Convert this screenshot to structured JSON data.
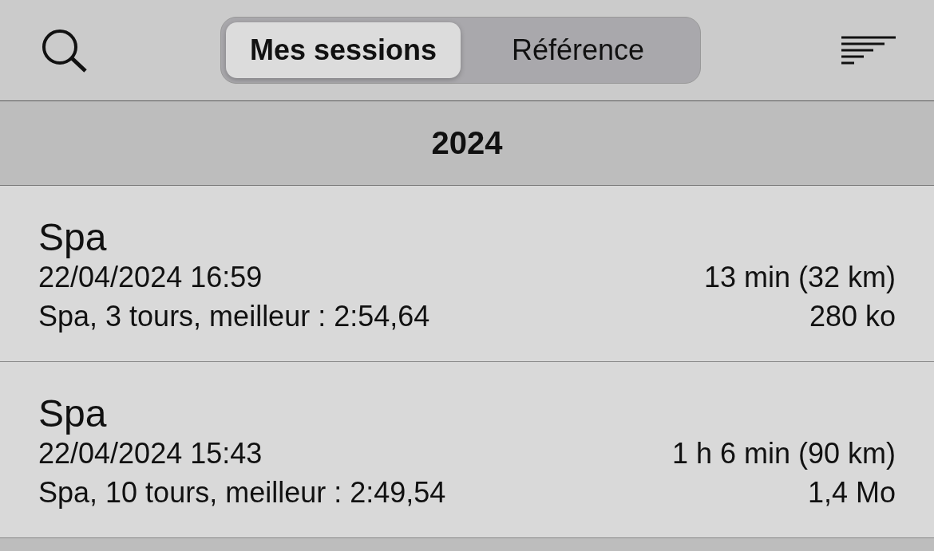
{
  "toolbar": {
    "tabs": [
      {
        "label": "Mes sessions",
        "selected": true
      },
      {
        "label": "Référence",
        "selected": false
      }
    ]
  },
  "sections": [
    {
      "title": "2024",
      "sessions": [
        {
          "name": "Spa",
          "date": "22/04/2024 16:59",
          "summary": "Spa, 3 tours, meilleur : 2:54,64",
          "duration": "13 min (32 km)",
          "size": "280 ko"
        },
        {
          "name": "Spa",
          "date": "22/04/2024 15:43",
          "summary": "Spa, 10 tours, meilleur : 2:49,54",
          "duration": "1 h 6 min (90 km)",
          "size": "1,4 Mo"
        }
      ]
    }
  ]
}
